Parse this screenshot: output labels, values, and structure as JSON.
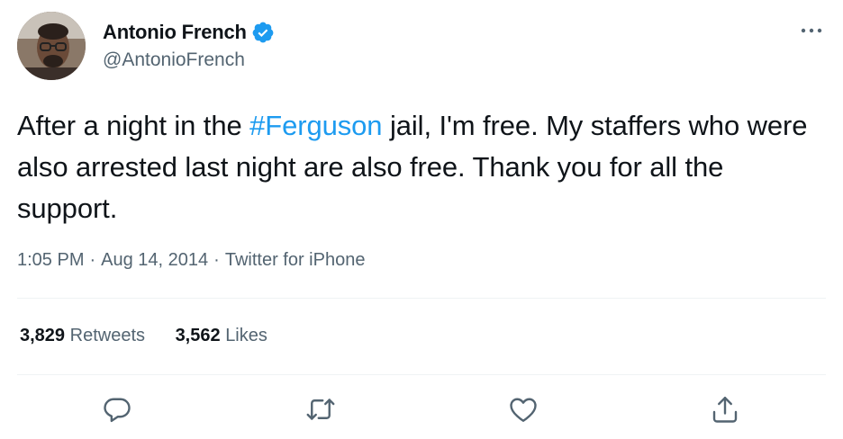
{
  "author": {
    "display_name": "Antonio French",
    "handle": "@AntonioFrench",
    "verified": true
  },
  "tweet": {
    "text_before": "After a night in the ",
    "hashtag": "#Ferguson",
    "text_after": " jail, I'm free. My staffers who were also arrested last night are also free. Thank you for all the support."
  },
  "meta": {
    "time": "1:05 PM",
    "separator": "·",
    "date": "Aug 14, 2014",
    "source": "Twitter for iPhone"
  },
  "stats": {
    "retweets_count": "3,829",
    "retweets_label": "Retweets",
    "likes_count": "3,562",
    "likes_label": "Likes"
  },
  "actions": {
    "icons": [
      "reply-icon",
      "retweet-icon",
      "like-icon",
      "share-icon"
    ]
  },
  "colors": {
    "link": "#1d9bf0",
    "secondary_text": "#536471",
    "primary_text": "#0f1419",
    "divider": "#eff3f4"
  }
}
